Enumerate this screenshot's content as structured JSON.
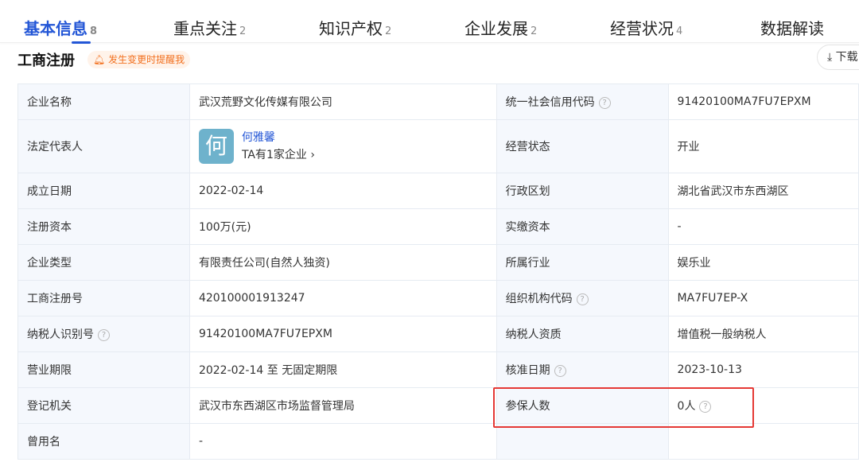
{
  "tabs": [
    {
      "label": "基本信息",
      "count": "8"
    },
    {
      "label": "重点关注",
      "count": "2"
    },
    {
      "label": "知识产权",
      "count": "2"
    },
    {
      "label": "企业发展",
      "count": "2"
    },
    {
      "label": "经营状况",
      "count": "4"
    },
    {
      "label": "数据解读",
      "count": ""
    }
  ],
  "section": {
    "title": "工商注册",
    "remind": "发生变更时提醒我",
    "download": "下载"
  },
  "rep": {
    "avatar": "何",
    "name": "何雅馨",
    "companies": "TA有1家企业"
  },
  "rows": [
    [
      "企业名称",
      "武汉荒野文化传媒有限公司",
      "统一社会信用代码",
      "91420100MA7FU7EPXM"
    ],
    [
      "法定代表人",
      "",
      "经营状态",
      "开业"
    ],
    [
      "成立日期",
      "2022-02-14",
      "行政区划",
      "湖北省武汉市东西湖区"
    ],
    [
      "注册资本",
      "100万(元)",
      "实缴资本",
      "-"
    ],
    [
      "企业类型",
      "有限责任公司(自然人独资)",
      "所属行业",
      "娱乐业"
    ],
    [
      "工商注册号",
      "420100001913247",
      "组织机构代码",
      "MA7FU7EP-X"
    ],
    [
      "纳税人识别号",
      "91420100MA7FU7EPXM",
      "纳税人资质",
      "增值税一般纳税人"
    ],
    [
      "营业期限",
      "2022-02-14 至 无固定期限",
      "核准日期",
      "2023-10-13"
    ],
    [
      "登记机关",
      "武汉市东西湖区市场监督管理局",
      "参保人数",
      "0人"
    ],
    [
      "曾用名",
      "-",
      "",
      ""
    ]
  ],
  "help": "?"
}
